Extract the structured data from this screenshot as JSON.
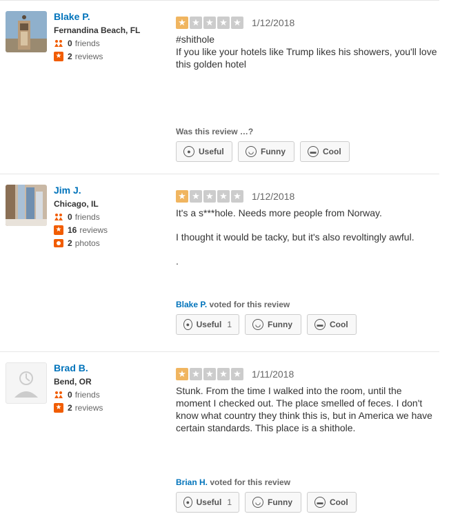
{
  "reviews": [
    {
      "user": {
        "name": "Blake P.",
        "location": "Fernandina Beach, FL",
        "friends": "0",
        "friends_label": "friends",
        "reviews": "2",
        "reviews_label": "reviews"
      },
      "rating": 1,
      "date": "1/12/2018",
      "text": [
        "#shithole",
        "If you like your hotels like Trump likes his showers, you'll love this golden hotel"
      ],
      "prompt": "Was this review …?",
      "buttons": {
        "useful": "Useful",
        "funny": "Funny",
        "cool": "Cool"
      }
    },
    {
      "user": {
        "name": "Jim J.",
        "location": "Chicago, IL",
        "friends": "0",
        "friends_label": "friends",
        "reviews": "16",
        "reviews_label": "reviews",
        "photos": "2",
        "photos_label": "photos"
      },
      "rating": 1,
      "date": "1/12/2018",
      "text": [
        "It's a s***hole.  Needs more people from Norway.",
        "I thought it would be tacky, but it's also revoltingly awful.",
        "."
      ],
      "voter": "Blake P.",
      "voted_label": "voted for this review",
      "buttons": {
        "useful": "Useful",
        "useful_count": "1",
        "funny": "Funny",
        "cool": "Cool"
      }
    },
    {
      "user": {
        "name": "Brad B.",
        "location": "Bend, OR",
        "friends": "0",
        "friends_label": "friends",
        "reviews": "2",
        "reviews_label": "reviews"
      },
      "rating": 1,
      "date": "1/11/2018",
      "text": [
        "Stunk. From the time I walked into the room, until the moment I checked out. The place smelled of feces. I don't know what country they think this is, but in America we have certain standards. This place is a shithole."
      ],
      "voter": "Brian H.",
      "voted_label": "voted for this review",
      "buttons": {
        "useful": "Useful",
        "useful_count": "1",
        "funny": "Funny",
        "cool": "Cool"
      }
    }
  ],
  "colors": {
    "link": "#0073bb",
    "star_on": "#f0b560",
    "star_off": "#cccccc",
    "badge": "#f15c00"
  }
}
